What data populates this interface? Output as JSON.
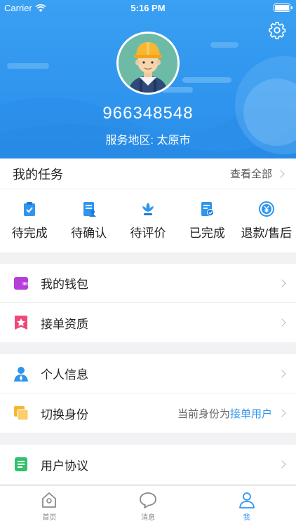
{
  "status_bar": {
    "carrier": "Carrier",
    "time": "5:16 PM"
  },
  "profile": {
    "user_id": "966348548",
    "service_area": "服务地区: 太原市"
  },
  "tasks": {
    "title": "我的任务",
    "view_all": "查看全部",
    "items": [
      {
        "label": "待完成",
        "icon": "clipboard-icon"
      },
      {
        "label": "待确认",
        "icon": "document-person-icon"
      },
      {
        "label": "待评价",
        "icon": "flower-icon"
      },
      {
        "label": "已完成",
        "icon": "document-check-icon"
      },
      {
        "label": "退款/售后",
        "icon": "yen-refund-icon"
      }
    ]
  },
  "menu": {
    "wallet": "我的钱包",
    "qualification": "接单资质",
    "personal_info": "个人信息",
    "switch_identity": "切换身份",
    "identity_prefix": "当前身份为",
    "identity_value": "接单用户",
    "agreement": "用户协议"
  },
  "tabbar": {
    "home": "首页",
    "messages": "消息",
    "me": "我"
  },
  "colors": {
    "accent": "#2f95ee",
    "wallet": "#b53ed9",
    "qualification": "#f0487a",
    "identity": "#f7b731",
    "agreement": "#33c06a"
  }
}
